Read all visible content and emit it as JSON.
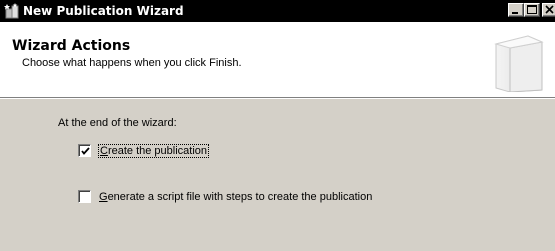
{
  "window": {
    "title": "New Publication Wizard",
    "icon": "wizard-app-icon"
  },
  "header": {
    "title": "Wizard Actions",
    "subtitle": "Choose what happens when you click Finish."
  },
  "content": {
    "intro": "At the end of the wizard:",
    "options": [
      {
        "mnemonic": "C",
        "label_rest": "reate the publication",
        "checked": true,
        "focused": true
      },
      {
        "mnemonic": "G",
        "label_rest": "enerate a script file with steps to create the publication",
        "checked": false,
        "focused": false
      }
    ]
  },
  "colors": {
    "titlebar": "#000000",
    "dialog_bg": "#d4d0c8",
    "header_bg": "#ffffff"
  }
}
